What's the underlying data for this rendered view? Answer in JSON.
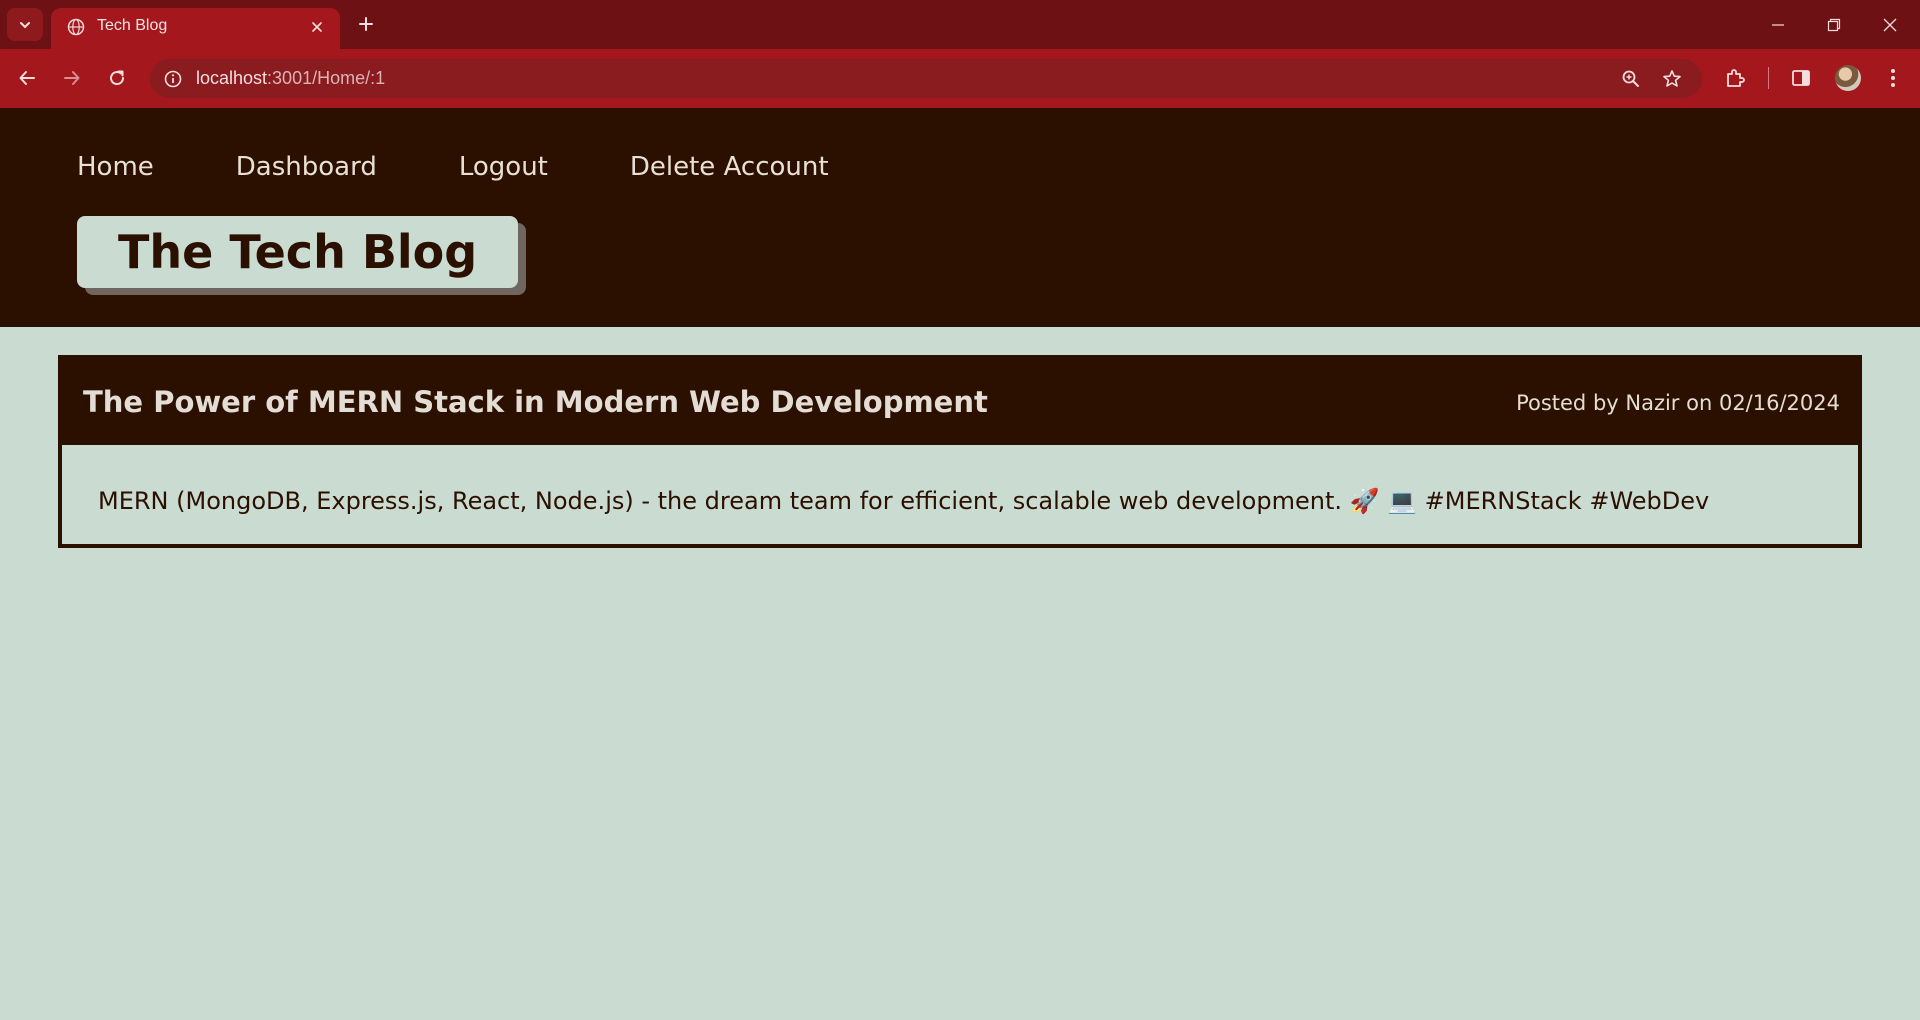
{
  "browser": {
    "tab_title": "Tech Blog",
    "url_host": "localhost",
    "url_path": ":3001/Home/:1"
  },
  "site": {
    "nav": [
      {
        "label": "Home"
      },
      {
        "label": "Dashboard"
      },
      {
        "label": "Logout"
      },
      {
        "label": "Delete Account"
      }
    ],
    "brand": "The Tech Blog"
  },
  "post": {
    "title": "The Power of MERN Stack in Modern Web Development",
    "meta": "Posted by Nazir on 02/16/2024",
    "body": "MERN (MongoDB, Express.js, React, Node.js) - the dream team for efficient, scalable web development. 🚀 💻 #MERNStack #WebDev"
  },
  "colors": {
    "tab_strip": "#6e1114",
    "toolbar": "#a4181d",
    "header_bg": "#2b1000",
    "page_bg": "#cadcd2",
    "text_light": "#e9dfd6"
  }
}
